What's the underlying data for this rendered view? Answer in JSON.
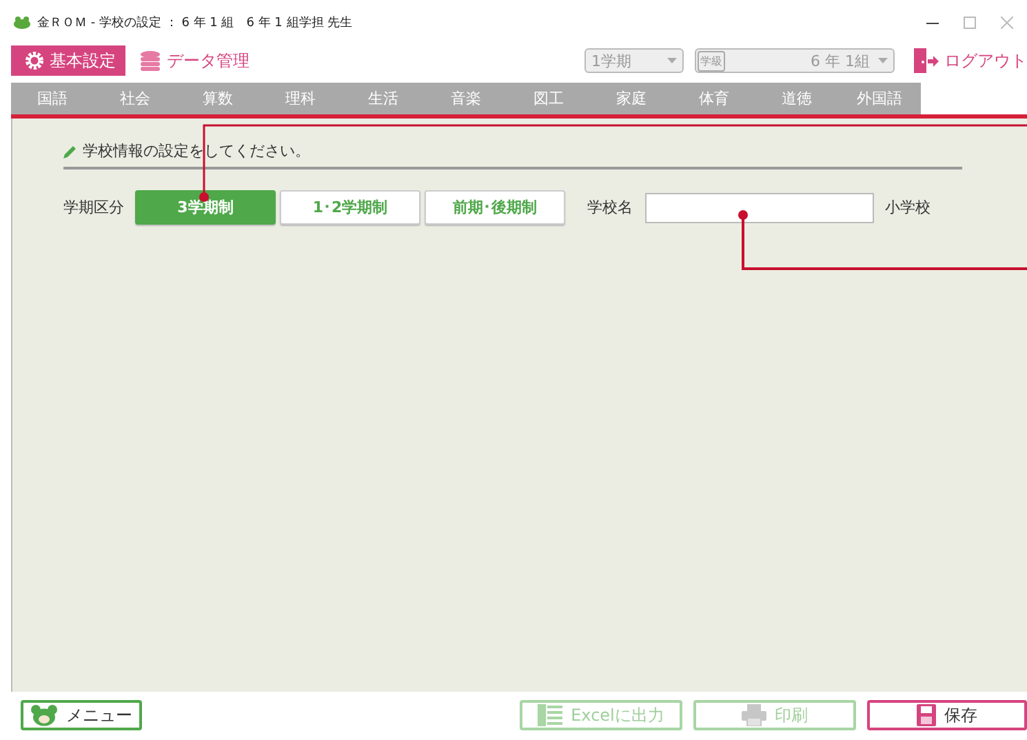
{
  "window": {
    "title": "金ＲＯＭ - 学校の設定 ： 6 年 1 組　6 年 1 組学担 先生"
  },
  "modes": [
    {
      "label": "基本設定",
      "kind": "gear",
      "selected": true
    },
    {
      "label": "データ管理",
      "kind": "database",
      "selected": false
    }
  ],
  "term_select": {
    "value": "1学期"
  },
  "class_select": {
    "label": "学級",
    "value": "6 年 1組"
  },
  "logout": {
    "label": "ログアウト"
  },
  "subject_tabs": [
    {
      "label": "国語",
      "disabled": true
    },
    {
      "label": "社会",
      "disabled": true
    },
    {
      "label": "算数",
      "disabled": true
    },
    {
      "label": "理科",
      "disabled": true
    },
    {
      "label": "生活",
      "disabled": true
    },
    {
      "label": "音楽",
      "disabled": true
    },
    {
      "label": "図工",
      "disabled": true
    },
    {
      "label": "家庭",
      "disabled": true
    },
    {
      "label": "体育",
      "disabled": true
    },
    {
      "label": "道徳",
      "disabled": true
    },
    {
      "label": "外国語",
      "disabled": true
    }
  ],
  "form": {
    "heading": "学校情報の設定をしてください。",
    "term_label": "学期区分",
    "term_options": [
      {
        "label": "3学期制",
        "selected": true
      },
      {
        "label": "1･2学期制",
        "selected": false
      },
      {
        "label": "前期･後期制",
        "selected": false
      }
    ],
    "school_name": {
      "label": "学校名",
      "suffix": "小学校"
    }
  },
  "footer_buttons": [
    {
      "label": "メニュー",
      "kind": "menu",
      "disabled": false
    },
    {
      "label": "Excelに出力",
      "kind": "excel",
      "disabled": true
    },
    {
      "label": "印刷",
      "kind": "print",
      "disabled": true
    },
    {
      "label": "保存",
      "kind": "save",
      "disabled": false
    }
  ]
}
